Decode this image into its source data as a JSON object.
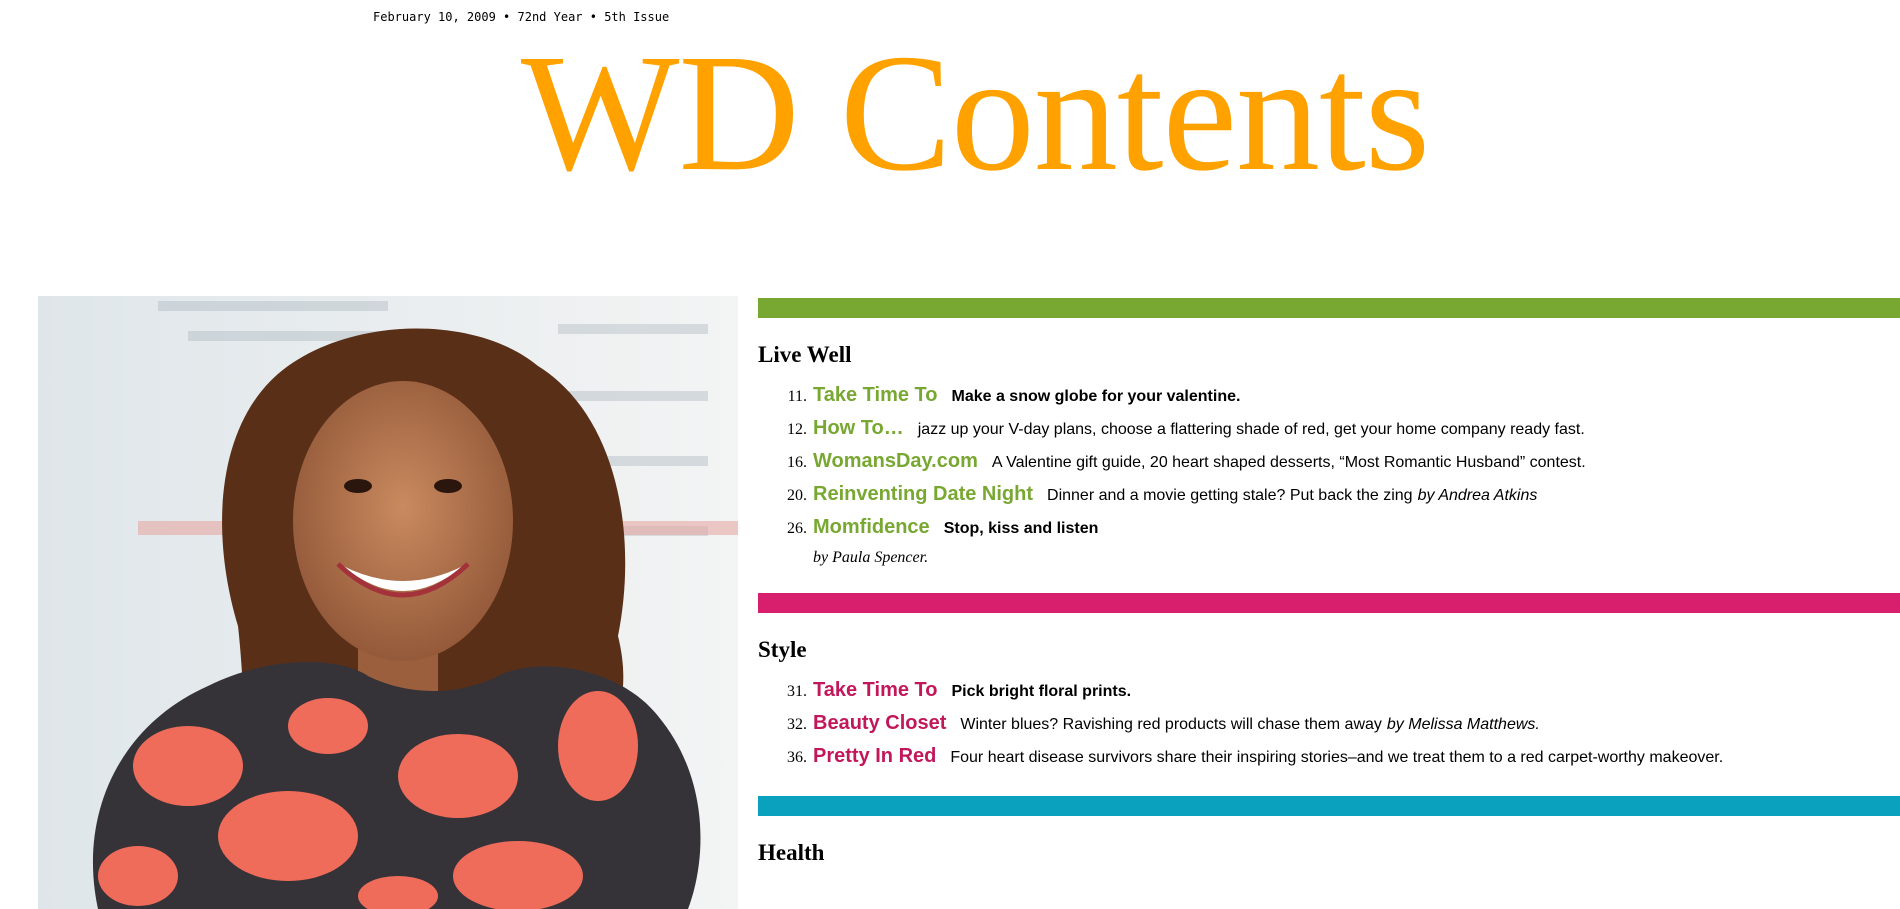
{
  "dateline": "February 10, 2009 • 72nd Year • 5th Issue",
  "masthead": "WD Contents",
  "colors": {
    "live_well": "#78a832",
    "style": "#d81f6e",
    "health": "#0aa1bf",
    "masthead": "#ffa200"
  },
  "sections": {
    "live_well": {
      "title": "Live Well",
      "items": [
        {
          "num": "11.",
          "head": "Take Time To",
          "desc": "Make a snow globe for your valentine.",
          "by": ""
        },
        {
          "num": "12.",
          "head": "How To…",
          "desc": "jazz up your V-day plans, choose a flattering shade of red, get your home company ready fast.",
          "by": ""
        },
        {
          "num": "16.",
          "head": "WomansDay.com",
          "desc": "A Valentine gift guide, 20 heart shaped desserts, “Most Romantic Husband” contest.",
          "by": ""
        },
        {
          "num": "20.",
          "head": "Reinventing Date Night",
          "desc": "Dinner and a movie getting stale? Put back the zing",
          "by": "by Andrea Atkins"
        },
        {
          "num": "26.",
          "head": "Momfidence",
          "desc": "Stop, kiss and listen",
          "by": ""
        }
      ],
      "sub_byline": "by Paula Spencer."
    },
    "style": {
      "title": "Style",
      "items": [
        {
          "num": "31.",
          "head": "Take Time To",
          "desc": "Pick bright floral prints.",
          "by": ""
        },
        {
          "num": "32.",
          "head": "Beauty Closet",
          "desc": "Winter blues? Ravishing red products will chase them away",
          "by": "by Melissa Matthews."
        },
        {
          "num": "36.",
          "head": "Pretty In Red",
          "desc": "Four heart disease survivors share their inspiring stories–and we treat them to a red carpet-worthy makeover.",
          "by": ""
        }
      ]
    },
    "health": {
      "title": "Health"
    }
  }
}
